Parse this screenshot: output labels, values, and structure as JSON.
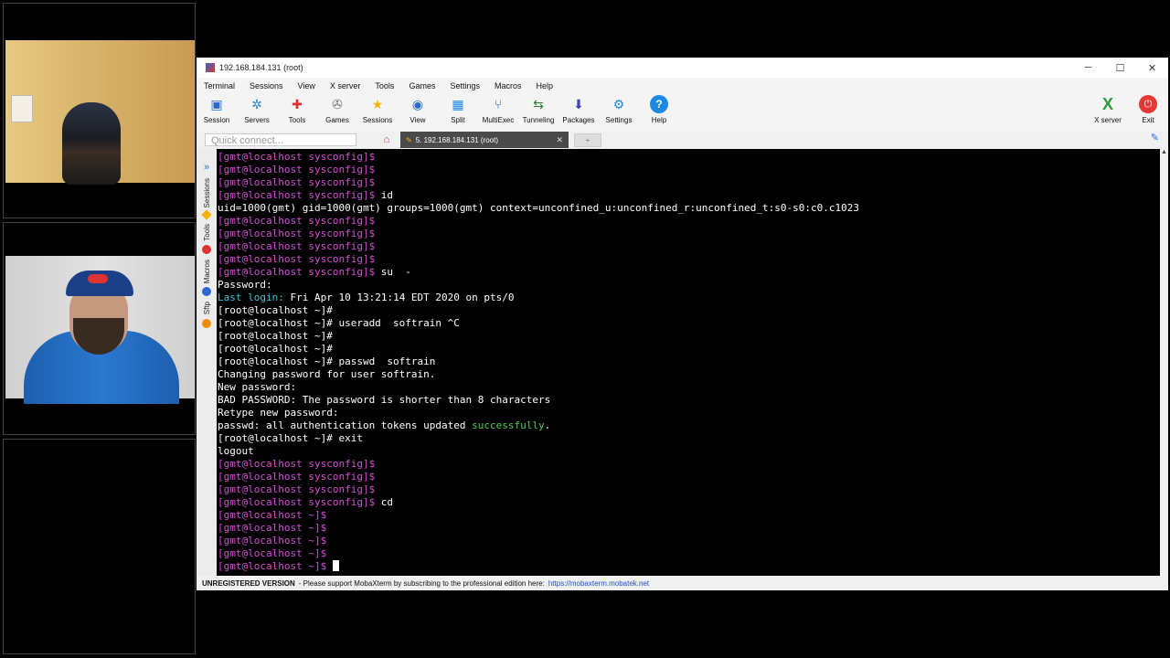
{
  "window": {
    "title": "192.168.184.131 (root)",
    "controls": [
      "─",
      "☐",
      "✕"
    ]
  },
  "menu": [
    "Terminal",
    "Sessions",
    "View",
    "X server",
    "Tools",
    "Games",
    "Settings",
    "Macros",
    "Help"
  ],
  "toolbar": {
    "left": [
      {
        "label": "Session",
        "icon": "session-icon"
      },
      {
        "label": "Servers",
        "icon": "servers-icon"
      },
      {
        "label": "Tools",
        "icon": "tools-icon"
      },
      {
        "label": "Games",
        "icon": "games-icon"
      },
      {
        "label": "Sessions",
        "icon": "star-icon"
      },
      {
        "label": "View",
        "icon": "view-icon"
      },
      {
        "label": "Split",
        "icon": "split-icon"
      },
      {
        "label": "MultiExec",
        "icon": "multiexec-icon"
      },
      {
        "label": "Tunneling",
        "icon": "tunneling-icon"
      },
      {
        "label": "Packages",
        "icon": "packages-icon"
      },
      {
        "label": "Settings",
        "icon": "settings-icon"
      },
      {
        "label": "Help",
        "icon": "help-icon"
      }
    ],
    "right": [
      {
        "label": "X server",
        "icon": "xserver-icon"
      },
      {
        "label": "Exit",
        "icon": "power-icon"
      }
    ]
  },
  "quick_connect": {
    "placeholder": "Quick connect..."
  },
  "tab": {
    "label": "5. 192.168.184.131 (root)"
  },
  "side_labels": [
    "Sessions",
    "Tools",
    "Macros",
    "Sftp"
  ],
  "terminal": [
    [
      [
        "u",
        "[gmt@localhost sysconfig]$"
      ]
    ],
    [
      [
        "u",
        "[gmt@localhost sysconfig]$"
      ]
    ],
    [
      [
        "u",
        "[gmt@localhost sysconfig]$"
      ]
    ],
    [
      [
        "u",
        "[gmt@localhost sysconfig]$"
      ],
      [
        "w",
        " id"
      ]
    ],
    [
      [
        "w",
        "uid=1000(gmt) gid=1000(gmt) groups=1000(gmt) context=unconfined_u:unconfined_r:unconfined_t:s0-s0:c0.c1023"
      ]
    ],
    [
      [
        "u",
        "[gmt@localhost sysconfig]$"
      ]
    ],
    [
      [
        "u",
        "[gmt@localhost sysconfig]$"
      ]
    ],
    [
      [
        "u",
        "[gmt@localhost sysconfig]$"
      ]
    ],
    [
      [
        "u",
        "[gmt@localhost sysconfig]$"
      ]
    ],
    [
      [
        "u",
        "[gmt@localhost sysconfig]$"
      ],
      [
        "w",
        " su  -"
      ]
    ],
    [
      [
        "w",
        "Password:"
      ]
    ],
    [
      [
        "c",
        "Last login:"
      ],
      [
        "w",
        " Fri Apr 10 13:21:14 EDT 2020 on pts/0"
      ]
    ],
    [
      [
        "w",
        "[root@localhost ~]#"
      ]
    ],
    [
      [
        "w",
        "[root@localhost ~]# useradd  softrain ^C"
      ]
    ],
    [
      [
        "w",
        "[root@localhost ~]#"
      ]
    ],
    [
      [
        "w",
        "[root@localhost ~]#"
      ]
    ],
    [
      [
        "w",
        "[root@localhost ~]# passwd  softrain"
      ]
    ],
    [
      [
        "w",
        "Changing password for user softrain."
      ]
    ],
    [
      [
        "w",
        "New password:"
      ]
    ],
    [
      [
        "w",
        "BAD PASSWORD: The password is shorter than 8 characters"
      ]
    ],
    [
      [
        "w",
        "Retype new password:"
      ]
    ],
    [
      [
        "w",
        "passwd: all authentication tokens updated "
      ],
      [
        "g",
        "successfully"
      ],
      [
        "w",
        "."
      ]
    ],
    [
      [
        "w",
        "[root@localhost ~]# exit"
      ]
    ],
    [
      [
        "w",
        "logout"
      ]
    ],
    [
      [
        "u",
        "[gmt@localhost sysconfig]$"
      ]
    ],
    [
      [
        "u",
        "[gmt@localhost sysconfig]$"
      ]
    ],
    [
      [
        "u",
        "[gmt@localhost sysconfig]$"
      ]
    ],
    [
      [
        "u",
        "[gmt@localhost sysconfig]$"
      ],
      [
        "w",
        " cd"
      ]
    ],
    [
      [
        "u",
        "[gmt@localhost ~]$"
      ]
    ],
    [
      [
        "u",
        "[gmt@localhost ~]$"
      ]
    ],
    [
      [
        "u",
        "[gmt@localhost ~]$"
      ]
    ],
    [
      [
        "u",
        "[gmt@localhost ~]$"
      ]
    ],
    [
      [
        "u",
        "[gmt@localhost ~]$"
      ],
      [
        "w",
        " "
      ]
    ]
  ],
  "status": {
    "label": "UNREGISTERED VERSION",
    "text": " -  Please support MobaXterm by subscribing to the professional edition here:",
    "link": "https://mobaxterm.mobatek.net"
  }
}
